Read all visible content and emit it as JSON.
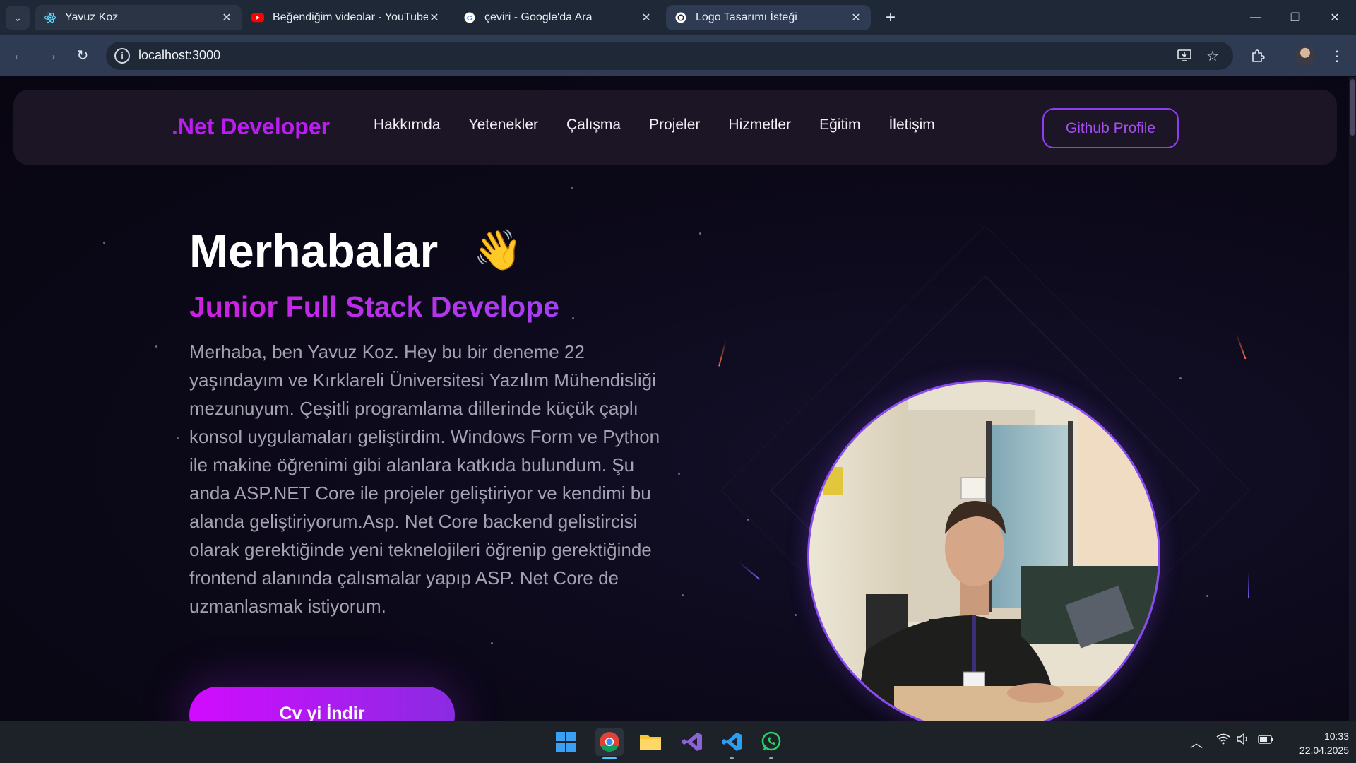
{
  "browser": {
    "tabs": [
      {
        "title": "Yavuz Koz",
        "icon": "react-icon"
      },
      {
        "title": "Beğendiğim videolar - YouTube",
        "icon": "youtube-icon"
      },
      {
        "title": "çeviri - Google'da Ara",
        "icon": "google-icon"
      },
      {
        "title": "Logo Tasarımı İsteği",
        "icon": "chatgpt-icon"
      }
    ],
    "url": "localhost:3000"
  },
  "site": {
    "brand": ".Net Developer",
    "menu": [
      "Hakkımda",
      "Yetenekler",
      "Çalışma",
      "Projeler",
      "Hizmetler",
      "Eğitim",
      "İletişim"
    ],
    "github_button": "Github Profile",
    "greeting": "Merhabalar",
    "wave_emoji": "👋",
    "role": "Junior Full Stack Develope",
    "bio": "Merhaba, ben Yavuz Koz. Hey bu bir deneme 22 yaşındayım ve Kırklareli Üniversitesi Yazılım Mühendisliği mezunuyum. Çeşitli programlama dillerinde küçük çaplı konsol uygulamaları geliştirdim. Windows Form ve Python ile makine öğrenimi gibi alanlara katkıda bulundum. Şu anda ASP.NET Core ile projeler geliştiriyor ve kendimi bu alanda geliştiriyorum.Asp. Net Core backend gelistircisi olarak gerektiğinde yeni teknelojileri öğrenip gerektiğinde frontend alanında çalısmalar yapıp ASP. Net Core de uzmanlasmak istiyorum.",
    "cv_button": "Cv yi İndir",
    "colors": {
      "accent": "#b91df0",
      "purple": "#8a2be2",
      "border": "#8e3ef0"
    }
  },
  "taskbar": {
    "apps": [
      "windows-start",
      "chrome",
      "file-explorer",
      "visual-studio",
      "vscode",
      "whatsapp"
    ],
    "time": "10:33",
    "date": "22.04.2025"
  }
}
